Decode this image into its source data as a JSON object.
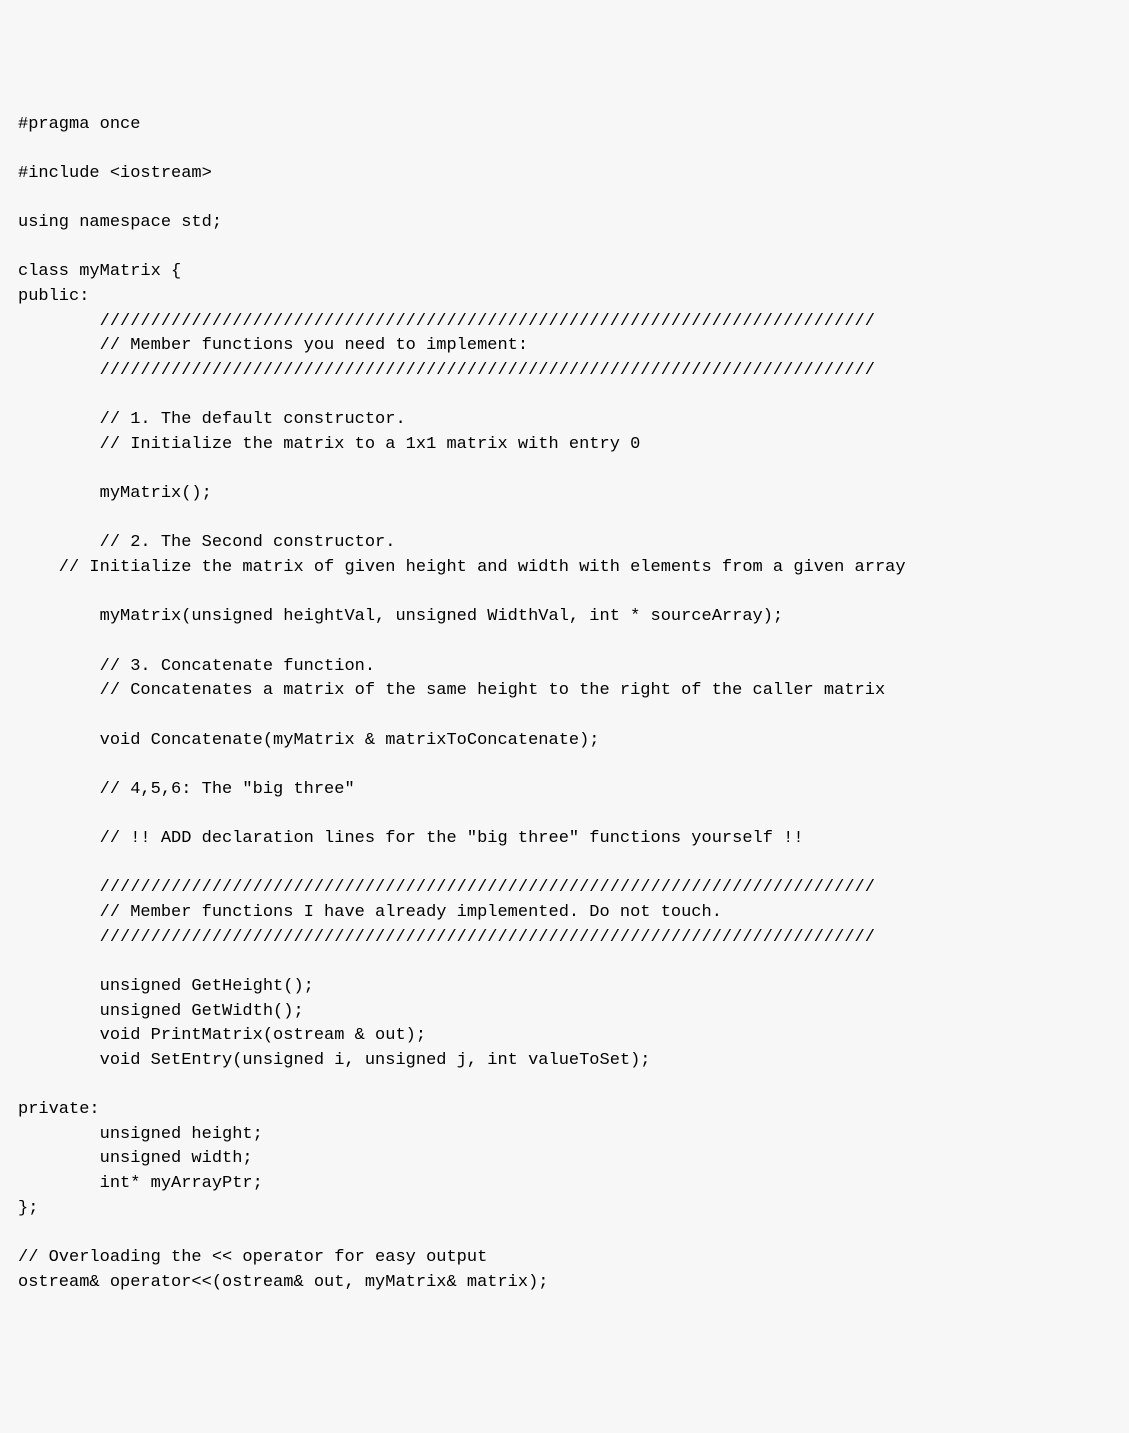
{
  "code": {
    "lines": [
      "#pragma once",
      "",
      "#include <iostream>",
      "",
      "using namespace std;",
      "",
      "class myMatrix {",
      "public:",
      "        ////////////////////////////////////////////////////////////////////////////",
      "        // Member functions you need to implement:",
      "        ////////////////////////////////////////////////////////////////////////////",
      "",
      "        // 1. The default constructor.",
      "        // Initialize the matrix to a 1x1 matrix with entry 0",
      "",
      "        myMatrix();",
      "",
      "        // 2. The Second constructor.",
      "    // Initialize the matrix of given height and width with elements from a given array",
      "",
      "        myMatrix(unsigned heightVal, unsigned WidthVal, int * sourceArray);",
      "",
      "        // 3. Concatenate function.",
      "        // Concatenates a matrix of the same height to the right of the caller matrix",
      "",
      "        void Concatenate(myMatrix & matrixToConcatenate);",
      "",
      "        // 4,5,6: The \"big three\"",
      "",
      "        // !! ADD declaration lines for the \"big three\" functions yourself !!",
      "",
      "        ////////////////////////////////////////////////////////////////////////////",
      "        // Member functions I have already implemented. Do not touch.",
      "        ////////////////////////////////////////////////////////////////////////////",
      "",
      "        unsigned GetHeight();",
      "        unsigned GetWidth();",
      "        void PrintMatrix(ostream & out);",
      "        void SetEntry(unsigned i, unsigned j, int valueToSet);",
      "",
      "private:",
      "        unsigned height;",
      "        unsigned width;",
      "        int* myArrayPtr;",
      "};",
      "",
      "// Overloading the << operator for easy output",
      "ostream& operator<<(ostream& out, myMatrix& matrix);"
    ]
  }
}
